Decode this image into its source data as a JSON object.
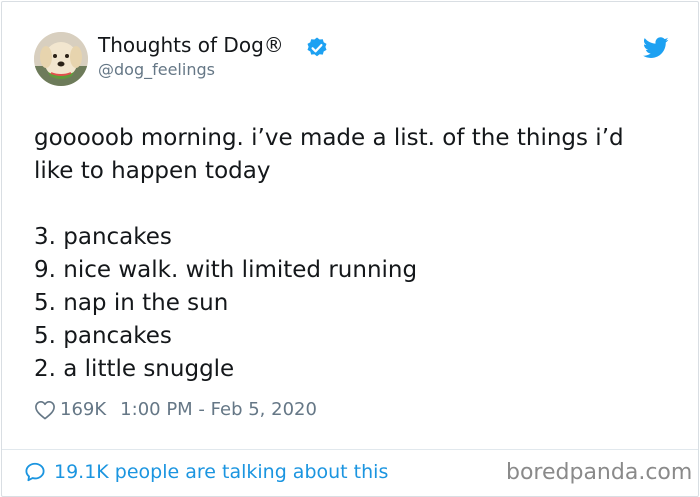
{
  "author": {
    "display_name": "Thoughts of Dog®",
    "handle": "@dog_feelings",
    "verified": true,
    "avatar_icon": "dog-avatar",
    "platform_icon": "twitter-bird-icon",
    "brand_color": "#1da1f2"
  },
  "tweet": {
    "intro_lines": [
      "gooooob morning. i’ve made a list. of the things i’d",
      "like to happen today"
    ],
    "list": [
      "3. pancakes",
      "9. nice walk. with limited running",
      "5. nap in the sun",
      "5. pancakes",
      "2. a little snuggle"
    ]
  },
  "meta": {
    "likes": "169K",
    "timestamp": "1:00 PM - Feb 5, 2020",
    "heart_icon": "heart-outline-icon"
  },
  "footer": {
    "talking": "19.1K people are talking about this",
    "talking_icon": "speech-bubble-icon",
    "accent_color": "#1b95e0"
  },
  "watermark": "boredpanda.com"
}
